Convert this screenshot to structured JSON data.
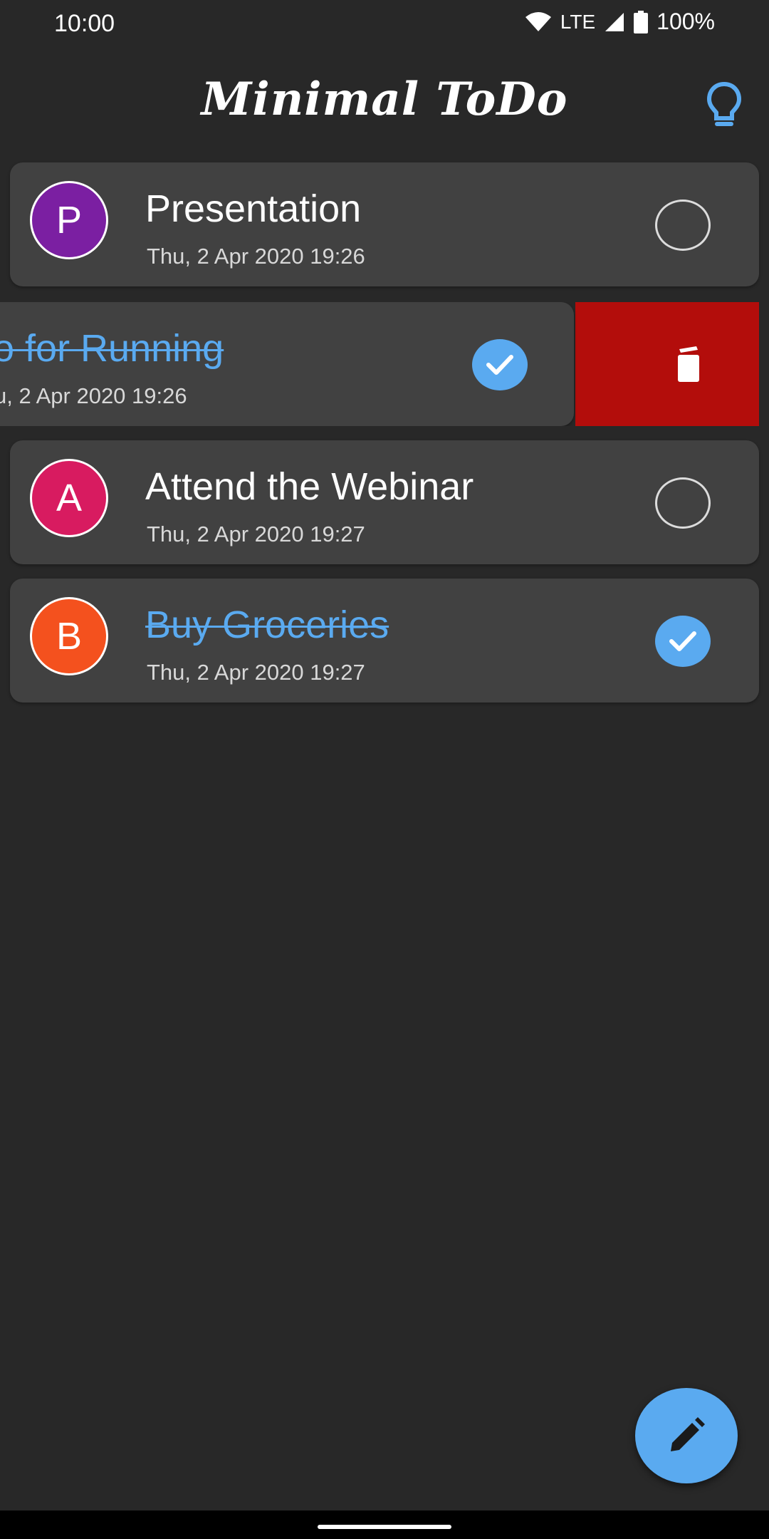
{
  "status_bar": {
    "time": "10:00",
    "network": "LTE",
    "battery": "100%"
  },
  "app_bar": {
    "title": "Minimal ToDo",
    "theme_icon": "lightbulb-icon",
    "accent_color": "#5aaaf0"
  },
  "tasks": [
    {
      "initial": "P",
      "title": "Presentation",
      "date": "Thu, 2 Apr 2020 19:26",
      "done": false,
      "avatar_color": "#7b1fa2"
    },
    {
      "initial": "",
      "title": "o for Running",
      "date": "u, 2 Apr 2020 19:26",
      "done": true,
      "swiped": true
    },
    {
      "initial": "A",
      "title": "Attend the Webinar",
      "date": "Thu, 2 Apr 2020 19:27",
      "done": false,
      "avatar_color": "#d81b60"
    },
    {
      "initial": "B",
      "title": "Buy Groceries",
      "date": "Thu, 2 Apr 2020 19:27",
      "done": true,
      "avatar_color": "#f4511e"
    }
  ],
  "swipe_action": {
    "icon": "trash-icon",
    "color": "#b30d0b"
  },
  "fab": {
    "icon": "pencil-icon"
  }
}
